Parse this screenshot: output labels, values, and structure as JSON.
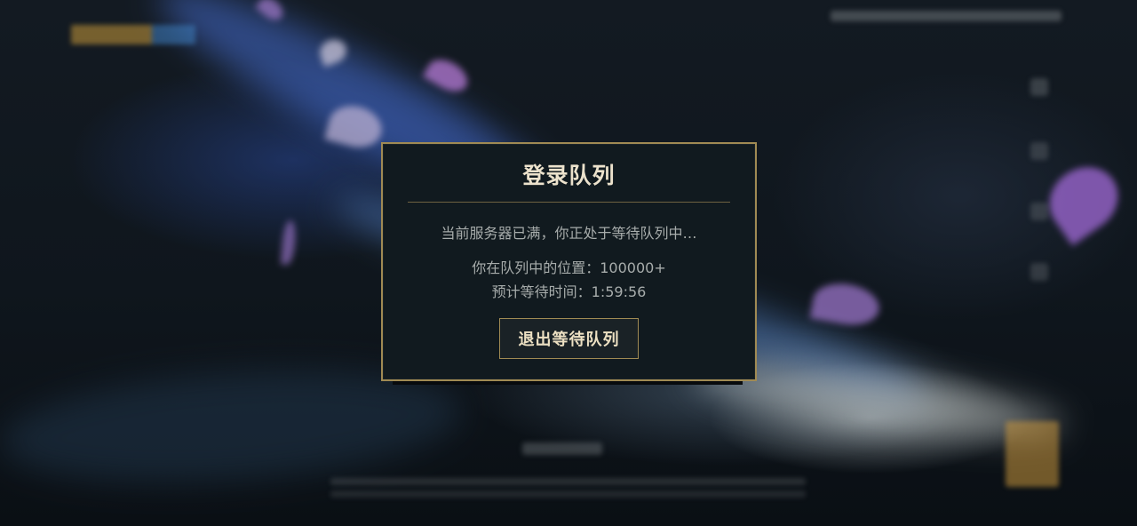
{
  "dialog": {
    "title": "登录队列",
    "status_message": "当前服务器已满，你正处于等待队列中…",
    "queue_position_label": "你在队列中的位置：100000+",
    "estimated_wait_label": "预计等待时间：1:59:56",
    "exit_button_label": "退出等待队列"
  },
  "colors": {
    "dialog_border": "#a08a53",
    "dialog_background": "#111a1f",
    "title_text": "#ece2cc",
    "body_text": "#a7acab"
  }
}
